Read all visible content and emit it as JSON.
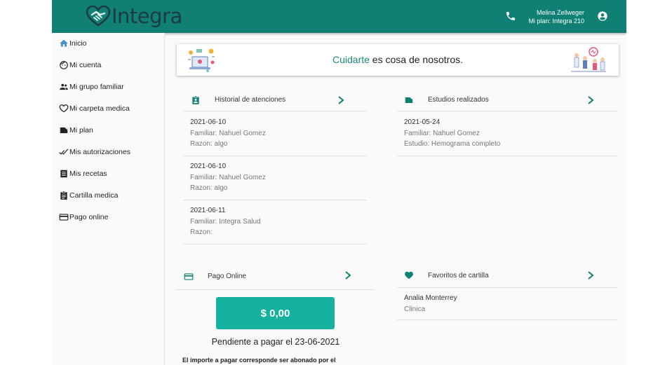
{
  "header": {
    "logo_text": "Integra",
    "user_name": "Melina Zellweger",
    "user_plan": "Mi plan: Integra 210",
    "brand_color": "#0f8073"
  },
  "sidebar": {
    "items": [
      {
        "label": "Inicio",
        "icon": "home-icon"
      },
      {
        "label": "Mi cuenta",
        "icon": "face-icon"
      },
      {
        "label": "Mi grupo familiar",
        "icon": "people-icon"
      },
      {
        "label": "Mi carpeta medica",
        "icon": "heart-outline-icon"
      },
      {
        "label": "Mi plan",
        "icon": "folder-icon"
      },
      {
        "label": "Mis autorizaciones",
        "icon": "double-check-icon"
      },
      {
        "label": "Mis recetas",
        "icon": "document-icon"
      },
      {
        "label": "Cartilla medica",
        "icon": "clipboard-icon"
      },
      {
        "label": "Pago online",
        "icon": "card-icon"
      }
    ]
  },
  "banner": {
    "accent": "Cuidarte",
    "text": " es cosa de nosotros."
  },
  "historial": {
    "title": "Historial de atenciones",
    "entries": [
      {
        "date": "2021-06-10",
        "familiar": "Familiar: Nahuel Gomez",
        "razon": "Razon: algo"
      },
      {
        "date": "2021-06-10",
        "familiar": "Familiar: Nahuel Gomez",
        "razon": "Razon: algo"
      },
      {
        "date": "2021-06-11",
        "familiar": "Familiar: Integra Salud",
        "razon": "Razon:"
      }
    ]
  },
  "estudios": {
    "title": "Estudios realizados",
    "entries": [
      {
        "date": "2021-05-24",
        "familiar": "Familiar: Nahuel Gomez",
        "estudio": "Estudio: Hemograma completo"
      }
    ]
  },
  "pago": {
    "title": "Pago Online",
    "amount": "$ 0,00",
    "pending": "Pendiente a pagar el 23-06-2021",
    "note": "El importe a pagar corresponde ser abonado por el"
  },
  "favoritos": {
    "title": "Favoritos de cartilla",
    "entries": [
      {
        "name": "Analia Monterrey",
        "type": "Clinica"
      }
    ]
  }
}
